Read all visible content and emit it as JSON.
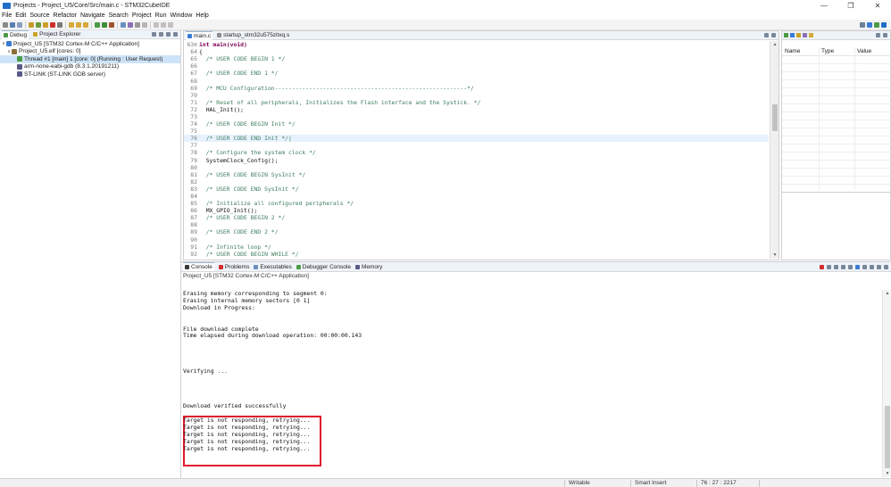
{
  "window": {
    "title": "Projects - Project_U5/Core/Src/main.c - STM32CubeIDE",
    "minimize": "—",
    "maximize": "❐",
    "close": "✕"
  },
  "menu": [
    "File",
    "Edit",
    "Source",
    "Refactor",
    "Navigate",
    "Search",
    "Project",
    "Run",
    "Window",
    "Help"
  ],
  "left_panel": {
    "tabs": [
      {
        "label": "Debug",
        "icon": "debug-icon",
        "active": true
      },
      {
        "label": "Project Explorer",
        "icon": "folder-icon",
        "active": false
      }
    ],
    "tree": [
      {
        "label": "Project_U5 [STM32 Cortex-M C/C++ Application]",
        "level": 0,
        "twisty": "∨",
        "icon": "launch-config-icon",
        "color": "#3a7bd5"
      },
      {
        "label": "Project_U5.elf [cores: 0]",
        "level": 1,
        "twisty": "∨",
        "icon": "process-icon",
        "color": "#8a6d3b"
      },
      {
        "label": "Thread #1 [main] 1 [core: 0] (Running : User Request)",
        "level": 2,
        "twisty": "",
        "icon": "thread-icon",
        "color": "#4c9a45",
        "selected": true
      },
      {
        "label": "arm-none-eabi-gdb (8.3.1.20191211)",
        "level": 1,
        "twisty": "",
        "icon": "gdb-icon",
        "color": "#5a5a8a"
      },
      {
        "label": "ST-LINK (ST-LINK GDB server)",
        "level": 1,
        "twisty": "",
        "icon": "stlink-icon",
        "color": "#5a5a8a"
      }
    ]
  },
  "editor": {
    "tabs": [
      {
        "label": "main.c",
        "active": true
      },
      {
        "label": "startup_stm32u575zitxq.s",
        "active": false
      }
    ],
    "lines": [
      {
        "n": "63⊖",
        "text": "int main(void)",
        "kind": "kw"
      },
      {
        "n": "64",
        "text": "{",
        "kind": "code"
      },
      {
        "n": "65",
        "text": "  /* USER CODE BEGIN 1 */",
        "kind": "cmt"
      },
      {
        "n": "66",
        "text": "",
        "kind": "code"
      },
      {
        "n": "67",
        "text": "  /* USER CODE END 1 */",
        "kind": "cmt"
      },
      {
        "n": "68",
        "text": "",
        "kind": "code"
      },
      {
        "n": "69",
        "text": "  /* MCU Configuration--------------------------------------------------------*/",
        "kind": "cmt"
      },
      {
        "n": "70",
        "text": "",
        "kind": "code"
      },
      {
        "n": "71",
        "text": "  /* Reset of all peripherals, Initializes the Flash interface and the Systick. */",
        "kind": "cmt"
      },
      {
        "n": "72",
        "text": "  HAL_Init();",
        "kind": "code"
      },
      {
        "n": "73",
        "text": "",
        "kind": "code"
      },
      {
        "n": "74",
        "text": "  /* USER CODE BEGIN Init */",
        "kind": "cmt"
      },
      {
        "n": "75",
        "text": "",
        "kind": "code"
      },
      {
        "n": "76",
        "text": "  /* USER CODE END Init */|",
        "kind": "cmt",
        "current": true
      },
      {
        "n": "77",
        "text": "",
        "kind": "code"
      },
      {
        "n": "78",
        "text": "  /* Configure the system clock */",
        "kind": "cmt"
      },
      {
        "n": "79",
        "text": "  SystemClock_Config();",
        "kind": "code"
      },
      {
        "n": "80",
        "text": "",
        "kind": "code"
      },
      {
        "n": "81",
        "text": "  /* USER CODE BEGIN SysInit */",
        "kind": "cmt"
      },
      {
        "n": "82",
        "text": "",
        "kind": "code"
      },
      {
        "n": "83",
        "text": "  /* USER CODE END SysInit */",
        "kind": "cmt"
      },
      {
        "n": "84",
        "text": "",
        "kind": "code"
      },
      {
        "n": "85",
        "text": "  /* Initialize all configured peripherals */",
        "kind": "cmt"
      },
      {
        "n": "86",
        "text": "  MX_GPIO_Init();",
        "kind": "code"
      },
      {
        "n": "87",
        "text": "  /* USER CODE BEGIN 2 */",
        "kind": "cmt"
      },
      {
        "n": "88",
        "text": "",
        "kind": "code"
      },
      {
        "n": "89",
        "text": "  /* USER CODE END 2 */",
        "kind": "cmt"
      },
      {
        "n": "90",
        "text": "",
        "kind": "code"
      },
      {
        "n": "91",
        "text": "  /* Infinite loop */",
        "kind": "cmt"
      },
      {
        "n": "92",
        "text": "  /* USER CODE BEGIN WHILE */",
        "kind": "cmt"
      }
    ]
  },
  "right_panel": {
    "columns": [
      "Name",
      "Type",
      "Value"
    ]
  },
  "console": {
    "tabs": [
      {
        "label": "Console",
        "icon": "console-icon"
      },
      {
        "label": "Problems",
        "icon": "problems-icon"
      },
      {
        "label": "Executables",
        "icon": "executables-icon"
      },
      {
        "label": "Debugger Console",
        "icon": "debugger-console-icon"
      },
      {
        "label": "Memory",
        "icon": "memory-icon"
      }
    ],
    "description": "Project_U5 [STM32 Cortex-M C/C++ Application]",
    "output": [
      {
        "text": "Erasing memory corresponding to segment 0:",
        "row": 0
      },
      {
        "text": "Erasing internal memory sectors [0 1]",
        "row": 1
      },
      {
        "text": "Download in Progress:",
        "row": 2
      },
      {
        "text": "File download complete",
        "row": 5
      },
      {
        "text": "Time elapsed during download operation: 00:00:00.143",
        "row": 6
      },
      {
        "text": "Verifying ...",
        "row": 11
      },
      {
        "text": "Download verified successfully",
        "row": 16
      },
      {
        "text": "Target is not responding, retrying...",
        "row": 18
      },
      {
        "text": "Target is not responding, retrying...",
        "row": 19
      },
      {
        "text": "Target is not responding, retrying...",
        "row": 20
      },
      {
        "text": "Target is not responding, retrying...",
        "row": 21
      },
      {
        "text": "Target is not responding, retrying...",
        "row": 22
      }
    ]
  },
  "status": {
    "writable": "Writable",
    "insert_mode": "Smart Insert",
    "position": "76 : 27 : 2217"
  },
  "colors": {
    "highlight_box": "#e0172c",
    "comment": "#3f7f5f",
    "keyword": "#7f0055",
    "selection": "#cde3f7"
  }
}
